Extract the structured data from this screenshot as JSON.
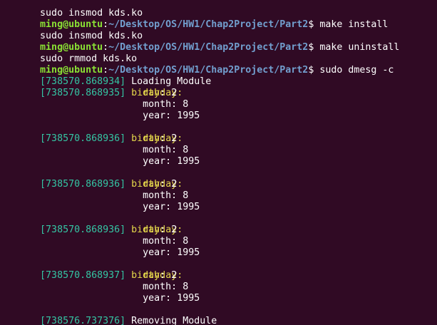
{
  "prompt": {
    "user_host": "ming@ubuntu",
    "separator": ":",
    "path": "~/Desktop/OS/HW1/Chap2Project/Part2",
    "symbol": "$"
  },
  "lines": {
    "l0": {
      "partial": "sudo insmod kds.ko"
    },
    "l1": {
      "command": "make install"
    },
    "l2": {
      "text": "sudo insmod kds.ko"
    },
    "l3": {
      "command": "make uninstall"
    },
    "l4": {
      "text": "sudo rmmod kds.ko"
    },
    "l5": {
      "command": "sudo dmesg -c"
    },
    "log1": {
      "timestamp": "[738570.868934]",
      "message": "Loading Module"
    },
    "b1": {
      "timestamp": "[738570.868935]",
      "label": "birthday:"
    },
    "b2": {
      "timestamp": "[738570.868936]",
      "label": "birthday:"
    },
    "b3": {
      "timestamp": "[738570.868936]",
      "label": "birthday:"
    },
    "b4": {
      "timestamp": "[738570.868936]",
      "label": "birthday:"
    },
    "b5": {
      "timestamp": "[738570.868937]",
      "label": "birthday:"
    },
    "log2": {
      "timestamp": "[738576.737376]",
      "message": "Removing Module"
    }
  },
  "fields": {
    "day_label": "day",
    "month_label": "month",
    "year_label": "year",
    "colon": ":",
    "day_value": "2",
    "month_value": "8",
    "year_value": "1995"
  },
  "colors": {
    "background": "#300a24",
    "user": "#8ae234",
    "path": "#729fcf",
    "timestamp": "#34c6a4",
    "keyword": "#e5d84b",
    "text": "#ffffff"
  }
}
